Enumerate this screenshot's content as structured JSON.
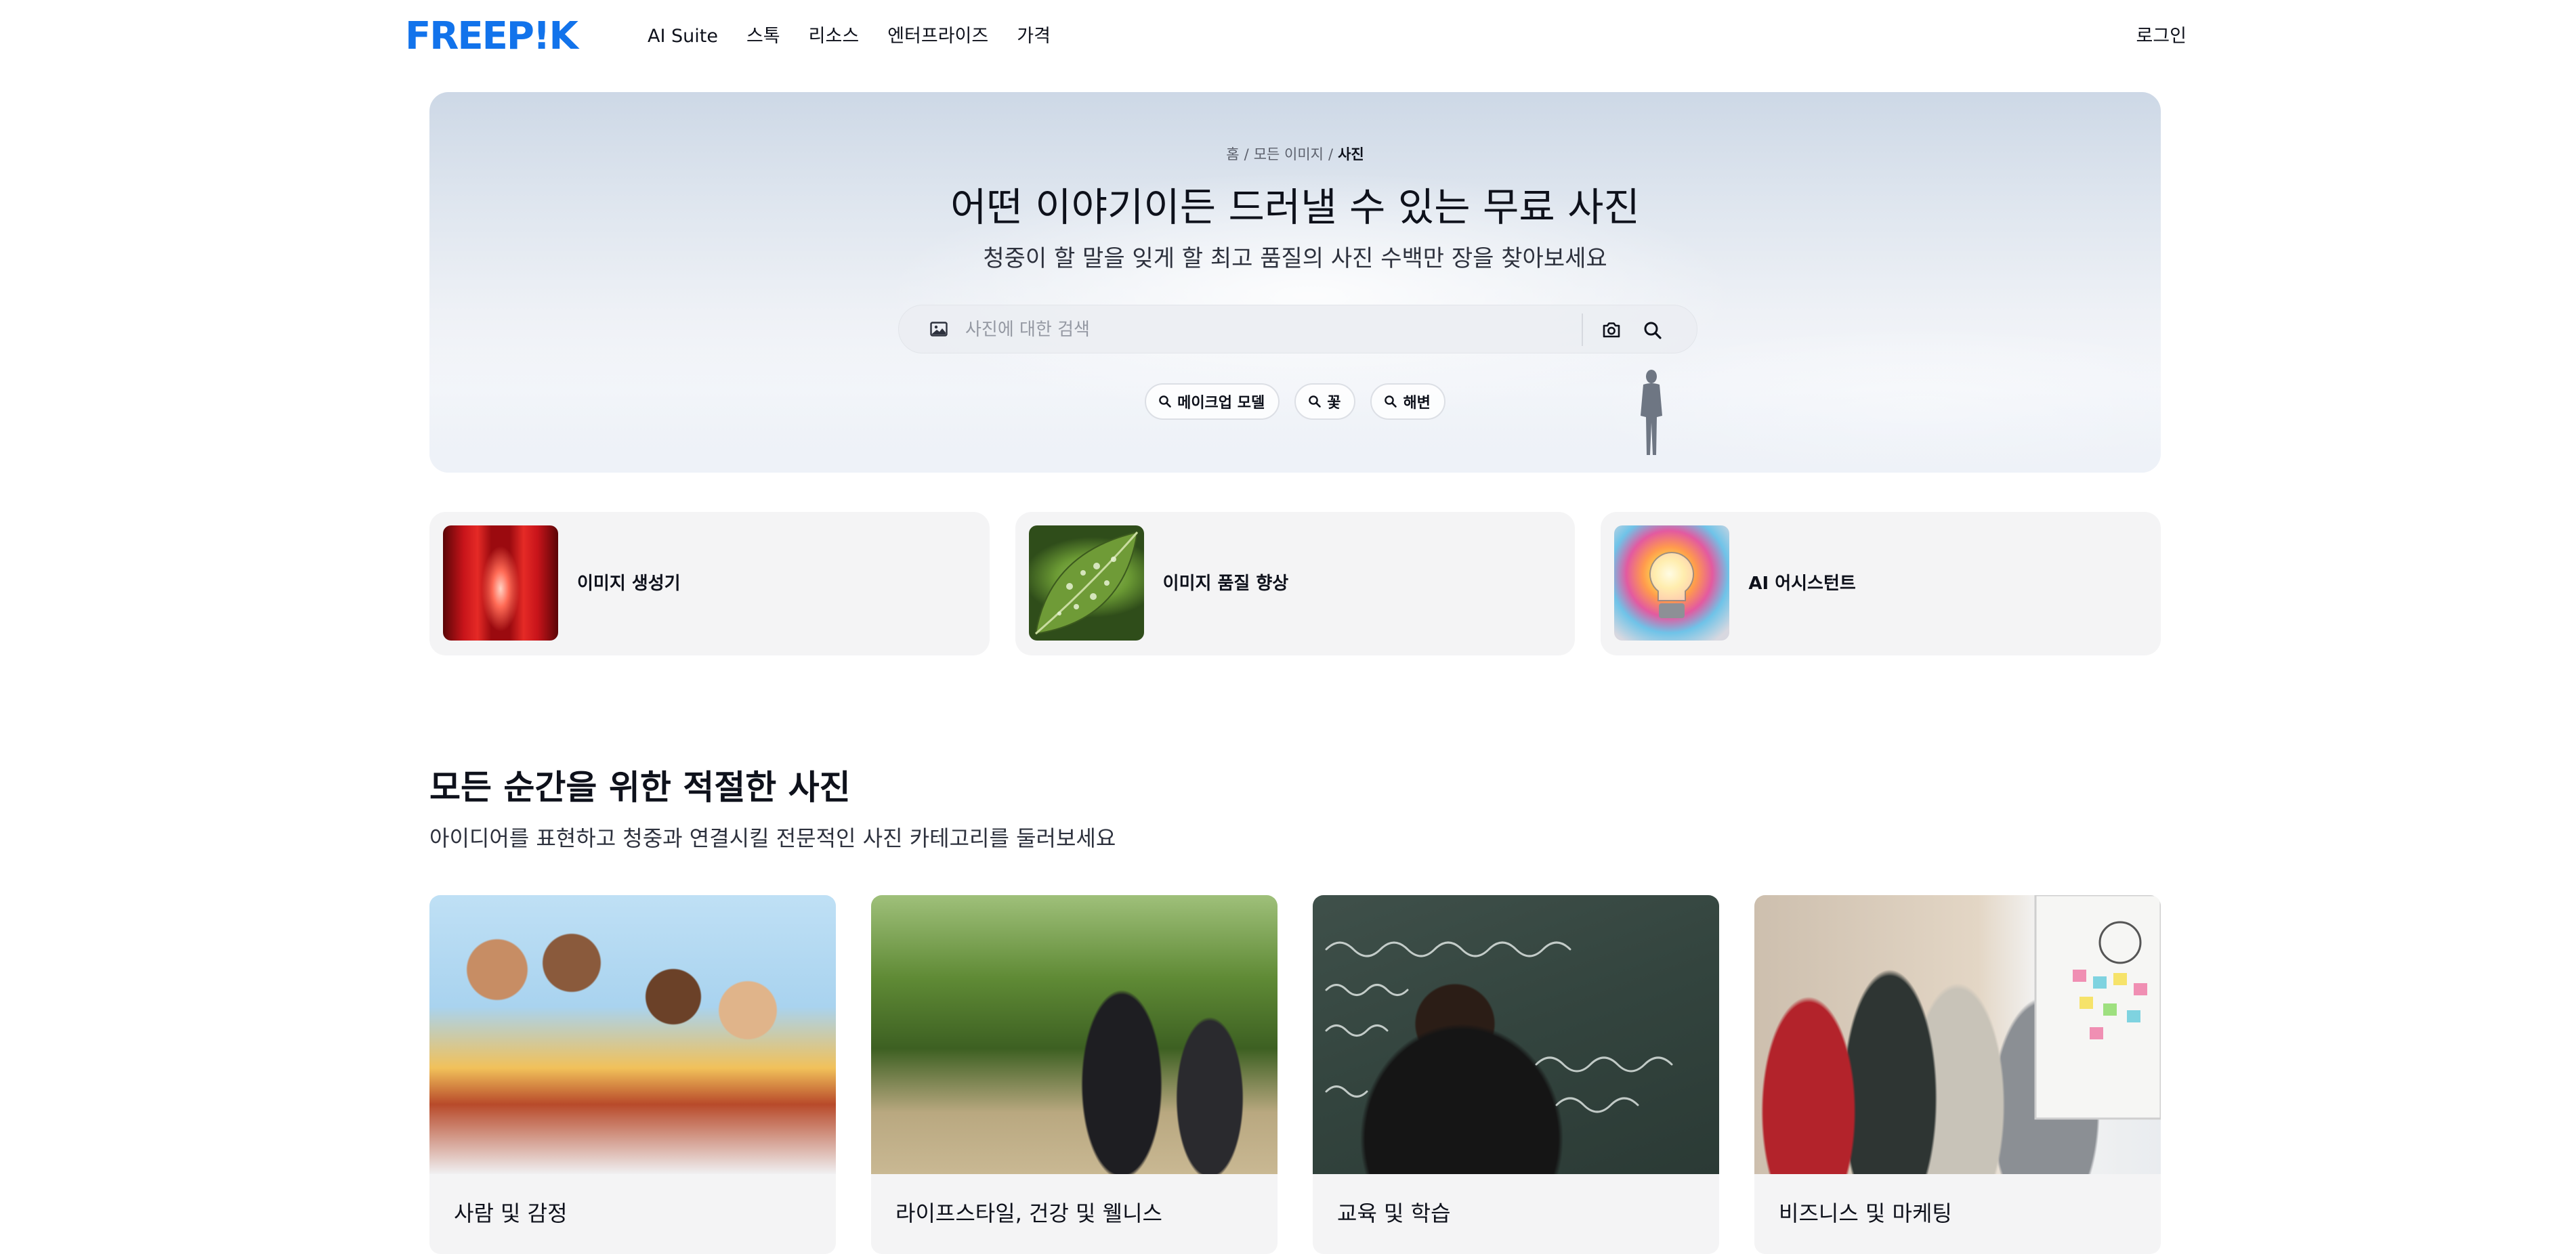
{
  "header": {
    "logo_text": "FREEP!K",
    "nav": [
      "AI Suite",
      "스톡",
      "리소스",
      "엔터프라이즈",
      "가격"
    ],
    "login_label": "로그인"
  },
  "hero": {
    "breadcrumb": [
      "홈",
      "모든 이미지",
      "사진"
    ],
    "title": "어떤 이야기이든 드러낼 수 있는 무료 사진",
    "subtitle": "청중이 할 말을 잊게 할 최고 품질의 사진 수백만 장을 찾아보세요",
    "search": {
      "placeholder": "사진에 대한 검색",
      "value": ""
    },
    "chips": [
      "메이크업 모델",
      "꽃",
      "해변"
    ]
  },
  "features": [
    {
      "label": "이미지 생성기",
      "thumb": "red-corridor"
    },
    {
      "label": "이미지 품질 향상",
      "thumb": "green-leaf-droplets"
    },
    {
      "label": "AI 어시스턴트",
      "thumb": "colorful-lightbulb"
    }
  ],
  "categories_section": {
    "title": "모든 순간을 위한 적절한 사진",
    "subtitle": "아이디어를 표현하고 청중과 연결시킬 전문적인 사진 카테고리를 둘러보세요",
    "items": [
      {
        "label": "사람 및 감정",
        "photo": "friends-group"
      },
      {
        "label": "라이프스타일, 건강 및 웰니스",
        "photo": "yoga-outdoors"
      },
      {
        "label": "교육 및 학습",
        "photo": "student-chalkboard"
      },
      {
        "label": "비즈니스 및 마케팅",
        "photo": "business-meeting"
      }
    ]
  },
  "colors": {
    "brand": "#1273eb",
    "text": "#0e111b",
    "card_bg": "#f4f4f5"
  }
}
